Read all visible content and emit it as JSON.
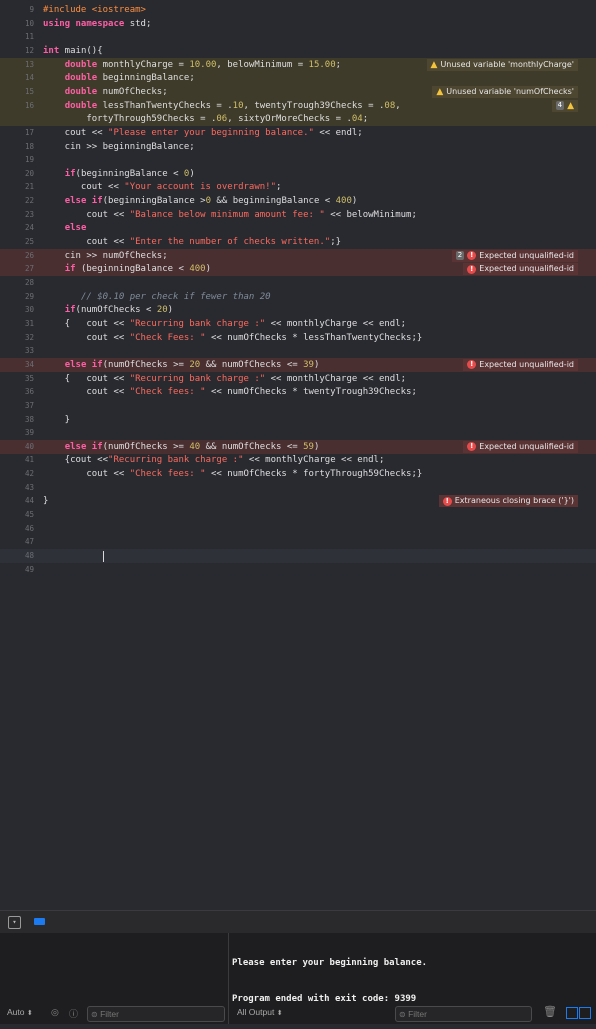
{
  "editor": {
    "lines": [
      {
        "n": "9",
        "t": "#include <iostream>",
        "cls": "",
        "diag": null
      },
      {
        "n": "10",
        "t": "using namespace std;",
        "cls": "",
        "diag": null
      },
      {
        "n": "11",
        "t": "",
        "cls": "",
        "diag": null
      },
      {
        "n": "12",
        "t": "int main(){",
        "cls": "",
        "diag": null
      },
      {
        "n": "13",
        "t": "    double monthlyCharge = 10.00, belowMinimum = 15.00;",
        "cls": "warn",
        "diag": {
          "type": "warning",
          "text": "Unused variable 'monthlyCharge'"
        }
      },
      {
        "n": "14",
        "t": "    double beginningBalance;",
        "cls": "warn",
        "diag": null
      },
      {
        "n": "15",
        "t": "    double numOfChecks;",
        "cls": "warn",
        "diag": {
          "type": "warning",
          "text": "Unused variable 'numOfChecks'"
        }
      },
      {
        "n": "16",
        "t": "    double lessThanTwentyChecks = .10, twentyTrough39Checks = .08,",
        "cls": "warn",
        "diag": {
          "type": "count",
          "text": "4"
        }
      },
      {
        "n": "",
        "t": "        fortyThrough59Checks = .06, sixtyOrMoreChecks = .04;",
        "cls": "warn",
        "diag": null
      },
      {
        "n": "17",
        "t": "    cout << \"Please enter your beginning balance.\" << endl;",
        "cls": "",
        "diag": null
      },
      {
        "n": "18",
        "t": "    cin >> beginningBalance;",
        "cls": "",
        "diag": null
      },
      {
        "n": "19",
        "t": "",
        "cls": "",
        "diag": null
      },
      {
        "n": "20",
        "t": "    if(beginningBalance < 0)",
        "cls": "",
        "diag": null
      },
      {
        "n": "21",
        "t": "       cout << \"Your account is overdrawn!\";",
        "cls": "",
        "diag": null
      },
      {
        "n": "22",
        "t": "    else if(beginningBalance >0 && beginningBalance < 400)",
        "cls": "",
        "diag": null
      },
      {
        "n": "23",
        "t": "        cout << \"Balance below minimum amount fee: \" << belowMinimum;",
        "cls": "",
        "diag": null
      },
      {
        "n": "24",
        "t": "    else",
        "cls": "",
        "diag": null
      },
      {
        "n": "25",
        "t": "        cout << \"Enter the number of checks written.\";}",
        "cls": "",
        "diag": null
      },
      {
        "n": "26",
        "t": "    cin >> numOfChecks;",
        "cls": "err",
        "diag": {
          "type": "error",
          "count": "2",
          "text": "Expected unqualified-id"
        }
      },
      {
        "n": "27",
        "t": "    if (beginningBalance < 400)",
        "cls": "err",
        "diag": {
          "type": "error",
          "text": "Expected unqualified-id"
        }
      },
      {
        "n": "28",
        "t": "",
        "cls": "",
        "diag": null
      },
      {
        "n": "29",
        "t": "       // $0.10 per check if fewer than 20",
        "cls": "",
        "diag": null
      },
      {
        "n": "30",
        "t": "    if(numOfChecks < 20)",
        "cls": "",
        "diag": null
      },
      {
        "n": "31",
        "t": "    {   cout << \"Recurring bank charge :\" << monthlyCharge << endl;",
        "cls": "",
        "diag": null
      },
      {
        "n": "32",
        "t": "        cout << \"Check Fees: \" << numOfChecks * lessThanTwentyChecks;}",
        "cls": "",
        "diag": null
      },
      {
        "n": "33",
        "t": "",
        "cls": "",
        "diag": null
      },
      {
        "n": "34",
        "t": "    else if(numOfChecks >= 20 && numOfChecks <= 39)",
        "cls": "err",
        "diag": {
          "type": "error",
          "text": "Expected unqualified-id"
        }
      },
      {
        "n": "35",
        "t": "    {   cout << \"Recurring bank charge :\" << monthlyCharge << endl;",
        "cls": "",
        "diag": null
      },
      {
        "n": "36",
        "t": "        cout << \"Check fees: \" << numOfChecks * twentyTrough39Checks;",
        "cls": "",
        "diag": null
      },
      {
        "n": "37",
        "t": "",
        "cls": "",
        "diag": null
      },
      {
        "n": "38",
        "t": "    }",
        "cls": "",
        "diag": null
      },
      {
        "n": "39",
        "t": "",
        "cls": "",
        "diag": null
      },
      {
        "n": "40",
        "t": "    else if(numOfChecks >= 40 && numOfChecks <= 59)",
        "cls": "err",
        "diag": {
          "type": "error",
          "text": "Expected unqualified-id"
        }
      },
      {
        "n": "41",
        "t": "    {cout <<\"Recurring bank charge :\" << monthlyCharge << endl;",
        "cls": "",
        "diag": null
      },
      {
        "n": "42",
        "t": "        cout << \"Check fees: \" << numOfChecks * fortyThrough59Checks;}",
        "cls": "",
        "diag": null
      },
      {
        "n": "43",
        "t": "",
        "cls": "",
        "diag": null
      },
      {
        "n": "44",
        "t": "}",
        "cls": "",
        "diag": {
          "type": "error",
          "text": "Extraneous closing brace ('}')"
        }
      },
      {
        "n": "45",
        "t": "",
        "cls": "",
        "diag": null
      },
      {
        "n": "46",
        "t": "",
        "cls": "",
        "diag": null
      },
      {
        "n": "47",
        "t": "",
        "cls": "",
        "diag": null
      },
      {
        "n": "48",
        "t": "",
        "cls": "cur",
        "diag": null
      },
      {
        "n": "49",
        "t": "",
        "cls": "",
        "diag": null
      }
    ]
  },
  "variables": {
    "scope_label": "Auto",
    "filter_placeholder": "Filter"
  },
  "console": {
    "output_lines": [
      "Please enter your beginning balance.",
      "Program ended with exit code: 9399"
    ],
    "output_selector": "All Output",
    "filter_placeholder": "Filter"
  }
}
